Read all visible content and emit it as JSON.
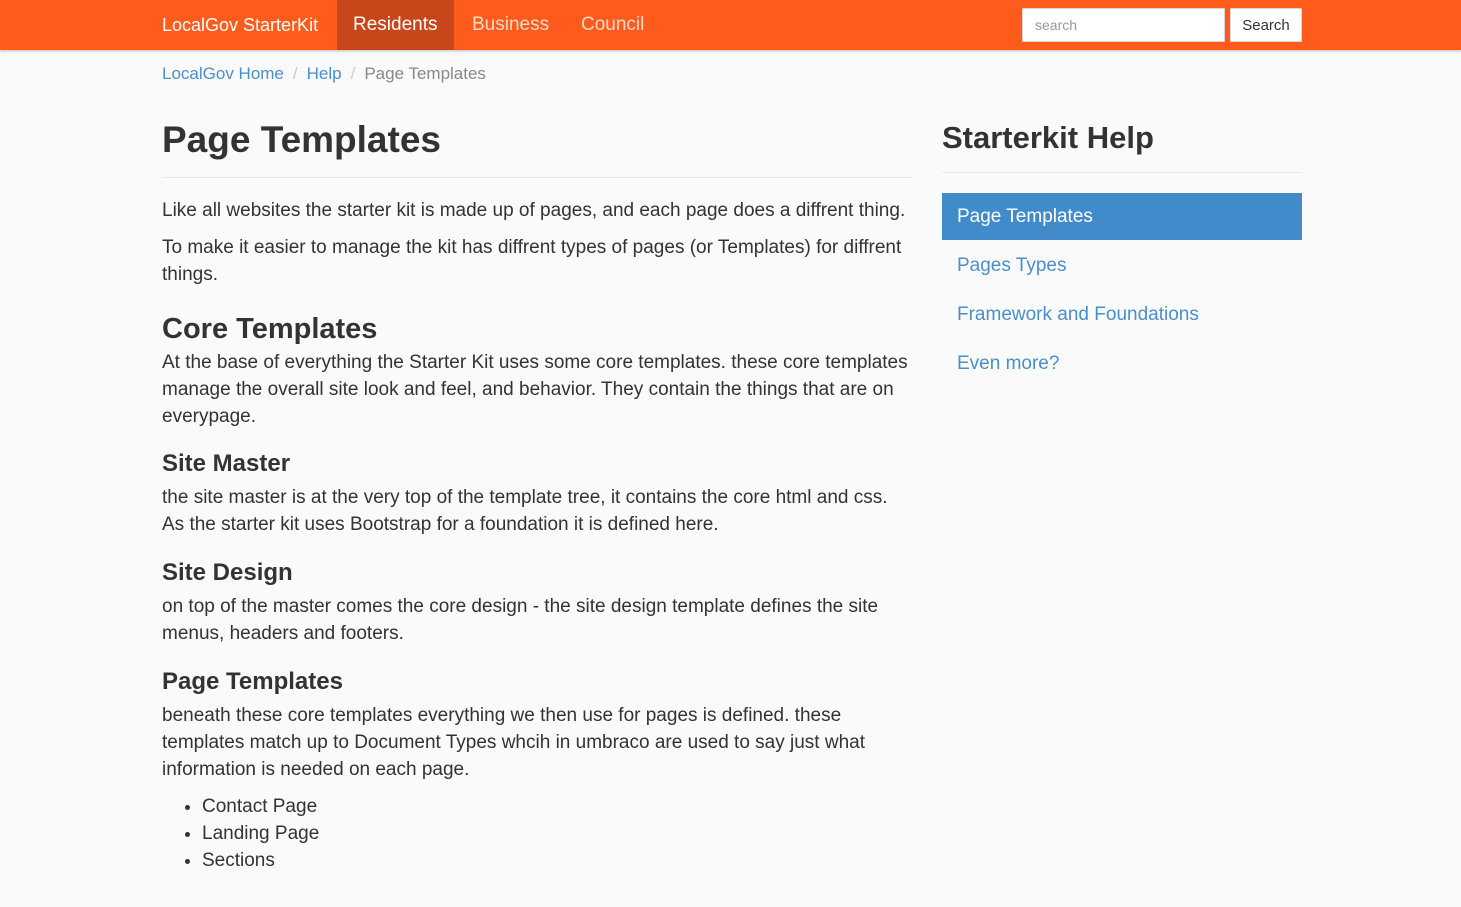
{
  "navbar": {
    "brand": "LocalGov StarterKit",
    "items": [
      {
        "label": "Residents"
      },
      {
        "label": "Business"
      },
      {
        "label": "Council"
      }
    ],
    "search": {
      "placeholder": "search",
      "button_label": "Search"
    }
  },
  "breadcrumb": {
    "items": [
      "LocalGov Home",
      "Help"
    ],
    "separator": "/",
    "current": "Page Templates"
  },
  "main": {
    "title": "Page Templates",
    "intro": [
      "Like all websites the starter kit is made up of pages, and each page does a diffrent thing.",
      "To make it easier to manage the kit has diffrent types of pages (or Templates) for diffrent things."
    ],
    "core": {
      "heading": "Core Templates",
      "text": "At the base of everything the Starter Kit uses some core templates. these core templates manage the overall site look and feel, and behavior. They contain the things that are on everypage."
    },
    "sections": [
      {
        "heading": "Site Master",
        "text": "the site master is at the very top of the template tree, it contains the core html and css. As the starter kit uses Bootstrap for a foundation it is defined here."
      },
      {
        "heading": "Site Design",
        "text": "on top of the master comes the core design - the site design template defines the site menus, headers and footers."
      },
      {
        "heading": "Page Templates",
        "text": "beneath these core templates everything we then use for pages is defined. these templates match up to Document Types whcih in umbraco are used to say just what information is needed on each page."
      }
    ],
    "list": [
      "Contact Page",
      "Landing Page",
      "Sections"
    ]
  },
  "sidebar": {
    "title": "Starterkit Help",
    "items": [
      {
        "label": "Page Templates"
      },
      {
        "label": "Pages Types"
      },
      {
        "label": "Framework and Foundations"
      },
      {
        "label": "Even more?"
      }
    ]
  },
  "colors": {
    "navbar": "#ff5b1c",
    "navbar_active": "#c8461a",
    "link": "#4a8fcc",
    "sidebar_active": "#428bca",
    "background": "#fafafa"
  }
}
